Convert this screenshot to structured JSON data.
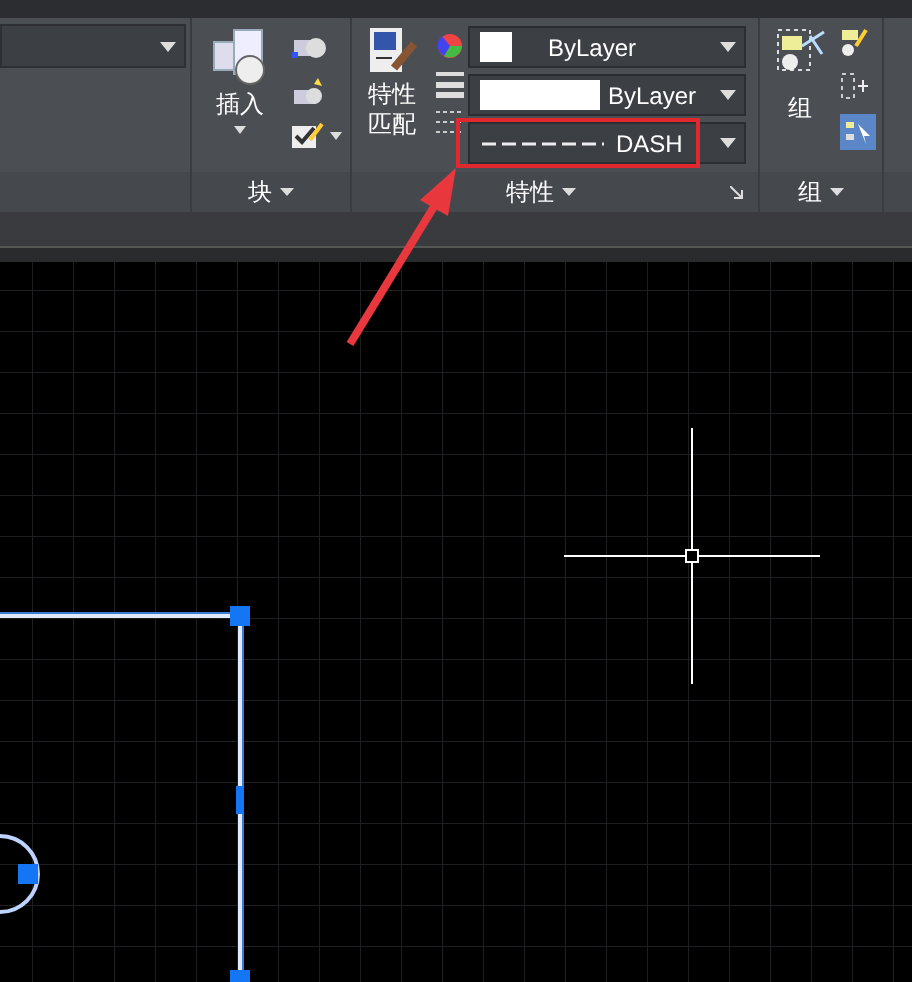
{
  "block_panel": {
    "insert_button": "插入",
    "title": "块"
  },
  "properties_panel": {
    "match_button": "特性匹配",
    "title": "特性",
    "dropdowns": [
      {
        "kind": "color",
        "value": "ByLayer",
        "highlighted": false
      },
      {
        "kind": "lineweight",
        "value": "ByLayer",
        "highlighted": false
      },
      {
        "kind": "linetype",
        "value": "DASH",
        "highlighted": true
      }
    ]
  },
  "group_panel": {
    "group_button": "组",
    "title": "组"
  },
  "annotation": {
    "arrow": true
  }
}
